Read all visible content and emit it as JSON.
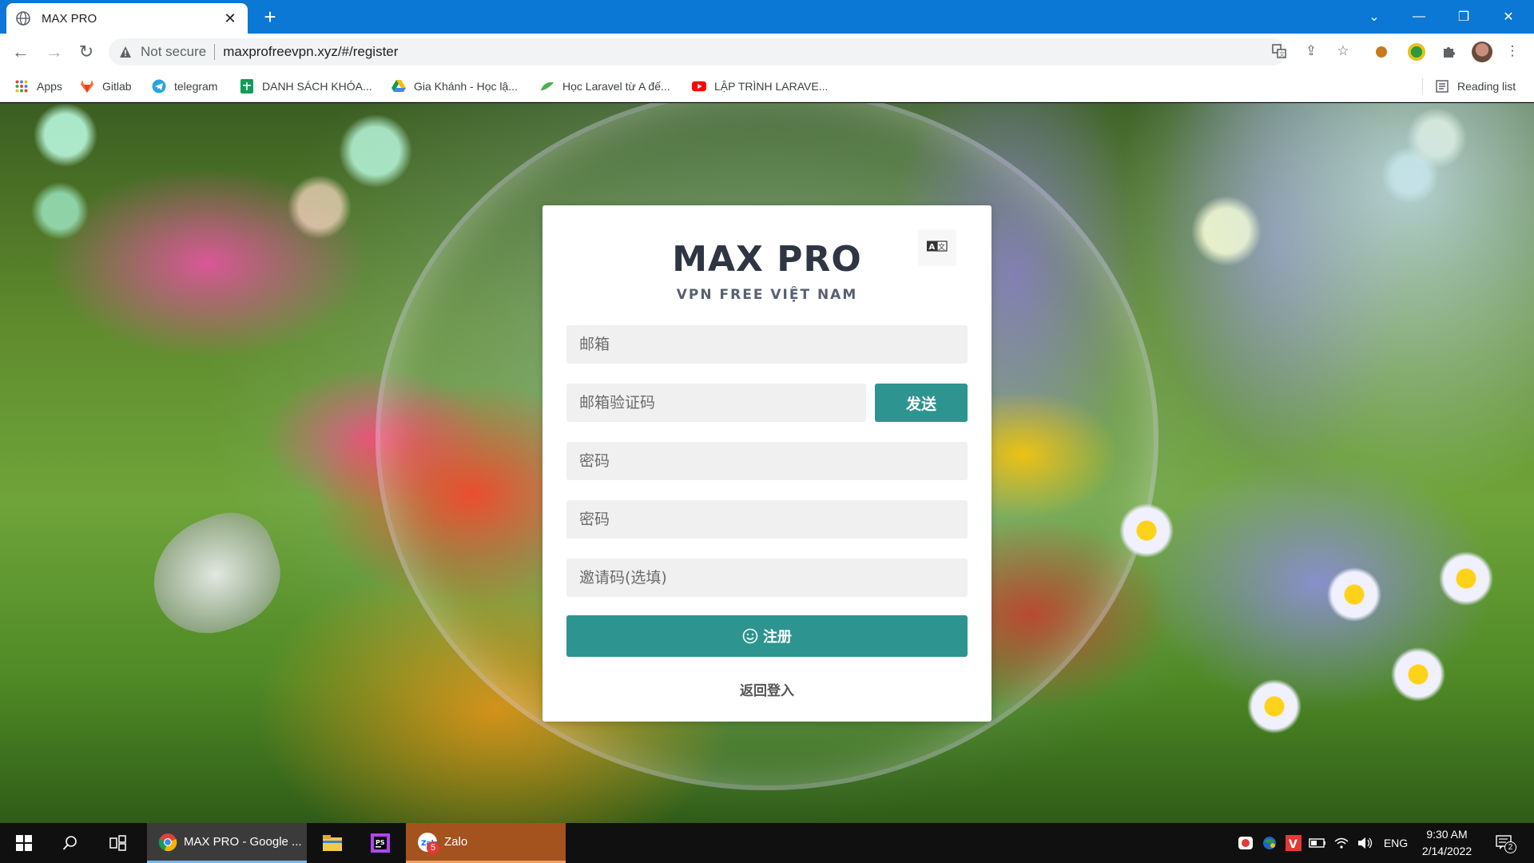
{
  "browser": {
    "tab_title": "MAX PRO",
    "address_status": "Not secure",
    "url": "maxprofreevpn.xyz/#/register",
    "bookmarks": [
      {
        "label": "Apps",
        "icon": "apps-grid-icon"
      },
      {
        "label": "Gitlab",
        "icon": "gitlab-icon"
      },
      {
        "label": "telegram",
        "icon": "telegram-icon"
      },
      {
        "label": "DANH SÁCH KHÓA...",
        "icon": "google-sheets-icon"
      },
      {
        "label": "Gia Khánh - Học lậ...",
        "icon": "google-drive-icon"
      },
      {
        "label": "Học Laravel từ A đế...",
        "icon": "leaf-icon"
      },
      {
        "label": "LẬP TRÌNH LARAVE...",
        "icon": "youtube-icon"
      }
    ],
    "reading_list": "Reading list"
  },
  "form": {
    "title": "MAX PRO",
    "subtitle": "VPN FREE VIỆT NAM",
    "email_placeholder": "邮箱",
    "email_code_placeholder": "邮箱验证码",
    "send_label": "发送",
    "password_placeholder": "密码",
    "password_confirm_placeholder": "密码",
    "invite_placeholder": "邀请码(选填)",
    "register_label": "注册",
    "back_to_login": "返回登入"
  },
  "taskbar": {
    "chrome_label": "MAX PRO - Google ...",
    "zalo_label": "Zalo",
    "zalo_badge": "5",
    "language": "ENG",
    "time": "9:30 AM",
    "date": "2/14/2022",
    "notification_count": "2"
  },
  "colors": {
    "tabbar": "#0a78d4",
    "accent": "#2e9490",
    "card": "#ffffff",
    "field_bg": "#f0f0f0"
  }
}
